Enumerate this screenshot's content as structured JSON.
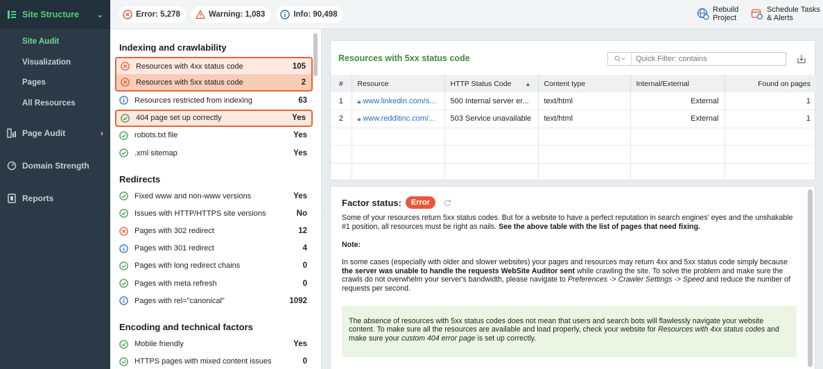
{
  "sidebar": {
    "header": "Site Structure",
    "subitems": [
      "Site Audit",
      "Visualization",
      "Pages",
      "All Resources"
    ],
    "sections": [
      "Page Audit",
      "Domain Strength",
      "Reports"
    ]
  },
  "topbar": {
    "error": "Error: 5,278",
    "warning": "Warning: 1,083",
    "info": "Info: 90,498",
    "rebuild_l1": "Rebuild",
    "rebuild_l2": "Project",
    "schedule_l1": "Schedule Tasks",
    "schedule_l2": "& Alerts"
  },
  "factors": {
    "groups": [
      {
        "title": "Indexing and crawlability",
        "items": [
          {
            "label": "Resources with 4xx status code",
            "value": "105",
            "status": "error"
          },
          {
            "label": "Resources with 5xx status code",
            "value": "2",
            "status": "error"
          },
          {
            "label": "Resources restricted from indexing",
            "value": "63",
            "status": "info"
          },
          {
            "label": "404 page set up correctly",
            "value": "Yes",
            "status": "ok"
          },
          {
            "label": "robots.txt file",
            "value": "Yes",
            "status": "ok"
          },
          {
            "label": ".xml sitemap",
            "value": "Yes",
            "status": "ok"
          }
        ]
      },
      {
        "title": "Redirects",
        "items": [
          {
            "label": "Fixed www and non-www versions",
            "value": "Yes",
            "status": "ok"
          },
          {
            "label": "Issues with HTTP/HTTPS site versions",
            "value": "No",
            "status": "ok"
          },
          {
            "label": "Pages with 302 redirect",
            "value": "12",
            "status": "error"
          },
          {
            "label": "Pages with 301 redirect",
            "value": "4",
            "status": "info"
          },
          {
            "label": "Pages with long redirect chains",
            "value": "0",
            "status": "ok"
          },
          {
            "label": "Pages with meta refresh",
            "value": "0",
            "status": "ok"
          },
          {
            "label": "Pages with rel=\"canonical\"",
            "value": "1092",
            "status": "info"
          }
        ]
      },
      {
        "title": "Encoding and technical factors",
        "items": [
          {
            "label": "Mobile friendly",
            "value": "Yes",
            "status": "ok"
          },
          {
            "label": "HTTPS pages with mixed content issues",
            "value": "0",
            "status": "ok"
          }
        ]
      }
    ]
  },
  "table_panel": {
    "title": "Resources with 5xx status code",
    "filter_placeholder": "Quick Filter: contains",
    "columns": [
      "#",
      "Resource",
      "HTTP Status Code",
      "Content type",
      "Internal/External",
      "Found on pages"
    ],
    "rows": [
      [
        "1",
        "www.linkedin.com/s...",
        "500 Internal server er...",
        "text/html",
        "External",
        "1"
      ],
      [
        "2",
        "www.redditinc.com/...",
        "503 Service unavailable",
        "text/html",
        "External",
        "1"
      ]
    ]
  },
  "status_panel": {
    "label": "Factor status:",
    "badge": "Error",
    "para1_a": "Some of your resources return 5xx status codes. But for a website to have a perfect reputation in search engines' eyes and the unshakable #1 position, all resources must be right as nails. ",
    "para1_b": "See the above table with the list of pages that need fixing.",
    "note": "Note:",
    "para2_a": "In some cases (especially with older and slower websites) your pages and resources may return 4xx and 5xx status code simply because ",
    "para2_b": "the server was unable to handle the requests WebSite Auditor sent",
    "para2_c": " while crawling the site. To solve the problem and make sure the crawls do not overwhelm your server's bandwidth, please navigate to ",
    "para2_d": "Preferences -> Crawler Settings -> Speed",
    "para2_e": " and reduce the number of requests per second.",
    "box_a": "The absence of resources with 5xx status codes does not mean that users and search bots will flawlessly navigate your website content. To make sure all the resources are available and load properly, check your website for ",
    "box_b": "Resources with 4xx status codes",
    "box_c": " and make sure your ",
    "box_d": "custom 404 error page",
    "box_e": " is set up correctly."
  },
  "colors": {
    "accent_green": "#4fd17a",
    "error": "#e9583a",
    "info": "#2a6ebb",
    "ok": "#3a9d4a"
  }
}
